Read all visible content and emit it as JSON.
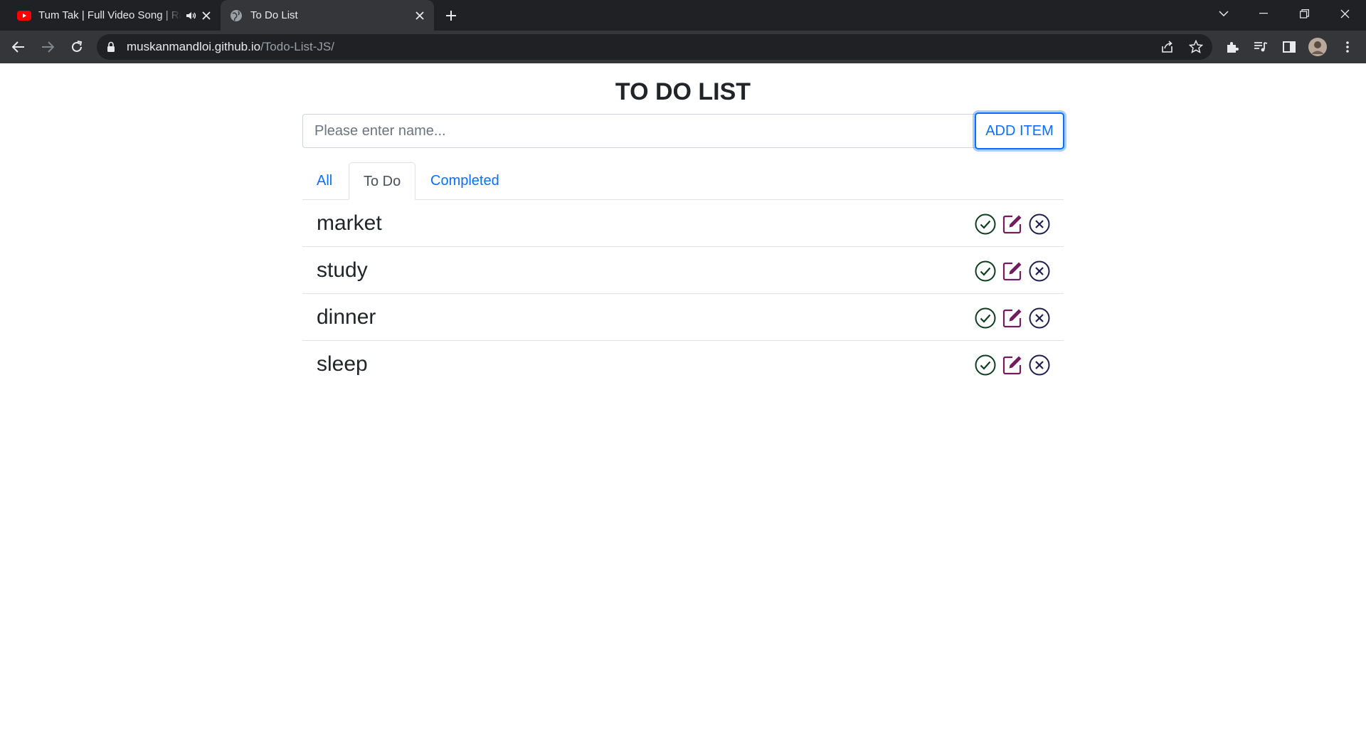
{
  "browser": {
    "tabs": [
      {
        "title": "Tum Tak | Full Video Song | Raanjhanaa"
      },
      {
        "title": "To Do List"
      }
    ],
    "url_host": "muskanmandloi.github.io",
    "url_path": "/Todo-List-JS/"
  },
  "page": {
    "title": "TO DO LIST",
    "input_placeholder": "Please enter name...",
    "input_value": "",
    "add_button": "ADD ITEM",
    "tabs": [
      {
        "label": "All",
        "active": false
      },
      {
        "label": "To Do",
        "active": true
      },
      {
        "label": "Completed",
        "active": false
      }
    ],
    "items": [
      {
        "text": "market"
      },
      {
        "text": "study"
      },
      {
        "text": "dinner"
      },
      {
        "text": "sleep"
      }
    ]
  },
  "icons": {
    "complete": "check-circle-icon",
    "edit": "edit-icon",
    "delete": "x-circle-icon"
  },
  "colors": {
    "primary": "#0d6efd",
    "complete_icon": "#0f3d1f",
    "edit_icon": "#6f1d5c",
    "delete_icon": "#1f1f4d"
  }
}
